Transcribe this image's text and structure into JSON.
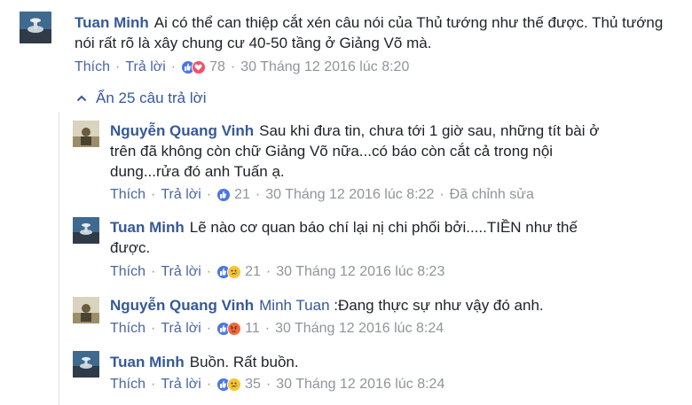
{
  "comments": [
    {
      "author": "Tuan Minh",
      "text": "Ai có thể can thiệp cắt xén câu nói của Thủ tướng như thế được. Thủ tướng nói rất rõ là xây chung cư 40-50 tầng ở Giảng Võ mà.",
      "like": "Thích",
      "reply": "Trả lời",
      "reactions": [
        "like",
        "love"
      ],
      "count": "78",
      "timestamp": "30 Tháng 12 2016 lúc 8:20"
    }
  ],
  "hide_replies": "Ẩn 25 câu trả lời",
  "replies": [
    {
      "author": "Nguyễn Quang Vinh",
      "line1": "Sau khi đưa tin, chưa tới 1 giờ sau, những tít bài ở",
      "line2": "trên đã không còn chữ Giảng Võ nữa...có báo còn cắt cả trong nội",
      "line3": "dung...rửa đó anh Tuấn ạ.",
      "like": "Thích",
      "reply": "Trả lời",
      "reactions": [
        "like"
      ],
      "count": "21",
      "timestamp": "30 Tháng 12 2016 lúc 8:22",
      "edited": "Đã chỉnh sửa"
    },
    {
      "author": "Tuan Minh",
      "line1": "Lẽ nào cơ quan báo chí lại nị chi phối bởi.....TIỀN như thế",
      "line2": "được.",
      "like": "Thích",
      "reply": "Trả lời",
      "reactions": [
        "like",
        "sad"
      ],
      "count": "21",
      "timestamp": "30 Tháng 12 2016 lúc 8:23"
    },
    {
      "author": "Nguyễn Quang Vinh",
      "mention": "Minh Tuan",
      "line1": ":Đang thực sự như vậy đó anh.",
      "like": "Thích",
      "reply": "Trả lời",
      "reactions": [
        "like",
        "angry"
      ],
      "count": "11",
      "timestamp": "30 Tháng 12 2016 lúc 8:24"
    },
    {
      "author": "Tuan Minh",
      "line1": "Buồn. Rất buồn.",
      "like": "Thích",
      "reply": "Trả lời",
      "reactions": [
        "like",
        "sad"
      ],
      "count": "35",
      "timestamp": "30 Tháng 12 2016 lúc 8:24"
    }
  ],
  "icons": {
    "like": "like-reaction-icon",
    "love": "love-reaction-icon",
    "sad": "sad-reaction-icon",
    "angry": "angry-reaction-icon",
    "chevron": "chevron-up-icon"
  },
  "colors": {
    "link": "#365899",
    "action": "#4b67a1",
    "meta": "#90949c",
    "like": "#4a76e8",
    "love": "#f25268",
    "sad": "#f7c531",
    "angry": "#ef6a3b"
  }
}
